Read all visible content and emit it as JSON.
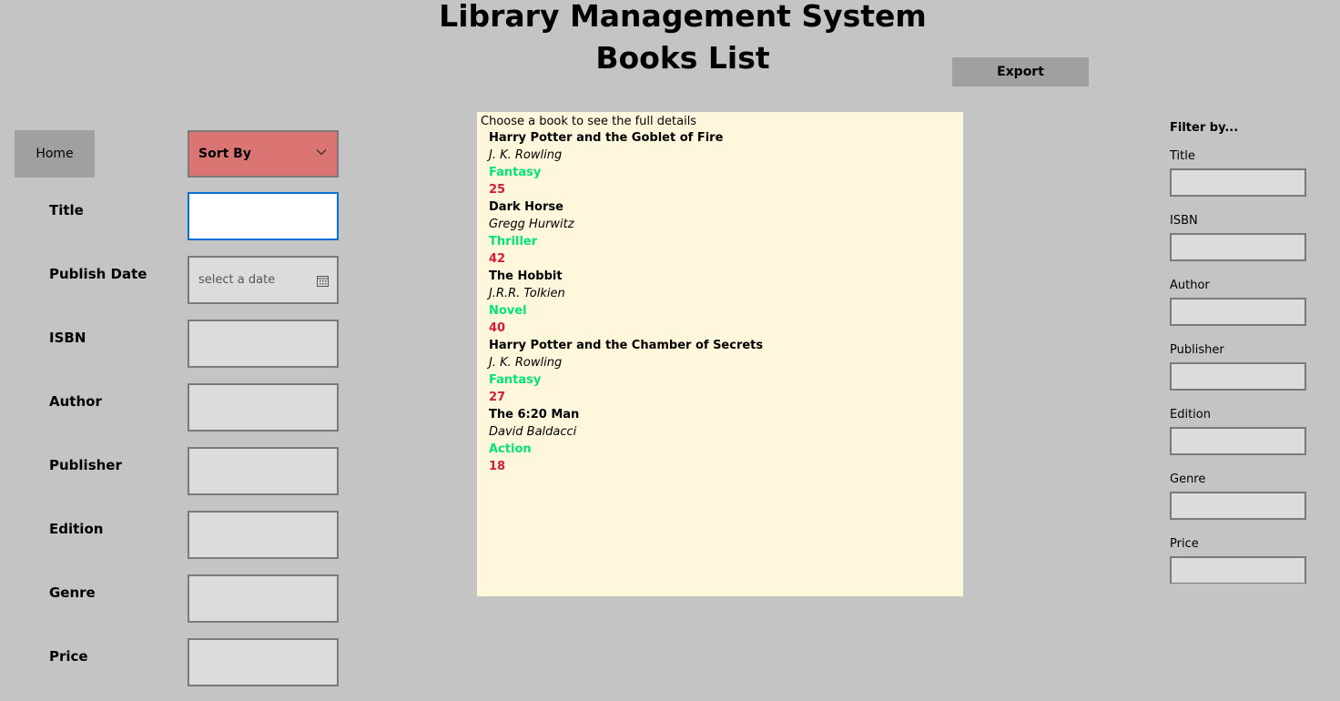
{
  "header": {
    "title": "Library Management System",
    "subtitle": "Books List",
    "export_label": "Export"
  },
  "nav": {
    "home_label": "Home"
  },
  "sort": {
    "label": "Sort By",
    "background": "#db7573"
  },
  "form": {
    "title_label": "Title",
    "publish_date_label": "Publish Date",
    "publish_date_placeholder": "select a date",
    "isbn_label": "ISBN",
    "author_label": "Author",
    "publisher_label": "Publisher",
    "edition_label": "Edition",
    "genre_label": "Genre",
    "price_label": "Price"
  },
  "books_panel": {
    "hint": "Choose a book to see the full details",
    "background": "#fff7dc",
    "books": [
      {
        "title": "Harry Potter and the Goblet of Fire",
        "author": "J. K. Rowling",
        "genre": "Fantasy",
        "price": "25"
      },
      {
        "title": "Dark Horse",
        "author": "Gregg Hurwitz",
        "genre": "Thriller",
        "price": "42"
      },
      {
        "title": "The Hobbit",
        "author": "J.R.R. Tolkien",
        "genre": "Novel",
        "price": "40"
      },
      {
        "title": "Harry Potter and the Chamber of Secrets",
        "author": "J. K. Rowling",
        "genre": "Fantasy",
        "price": "27"
      },
      {
        "title": "The 6:20 Man",
        "author": "David Baldacci",
        "genre": "Action",
        "price": "18"
      }
    ]
  },
  "filter": {
    "heading": "Filter by...",
    "title_label": "Title",
    "isbn_label": "ISBN",
    "author_label": "Author",
    "publisher_label": "Publisher",
    "edition_label": "Edition",
    "genre_label": "Genre",
    "price_label": "Price"
  },
  "colors": {
    "background": "#c4c4c4",
    "genre": "#00e676",
    "price": "#d81b3c",
    "focus_border": "#0a6fd6"
  },
  "icons": {
    "sort_chevron": "chevron-down-icon",
    "date_picker": "calendar-icon"
  }
}
